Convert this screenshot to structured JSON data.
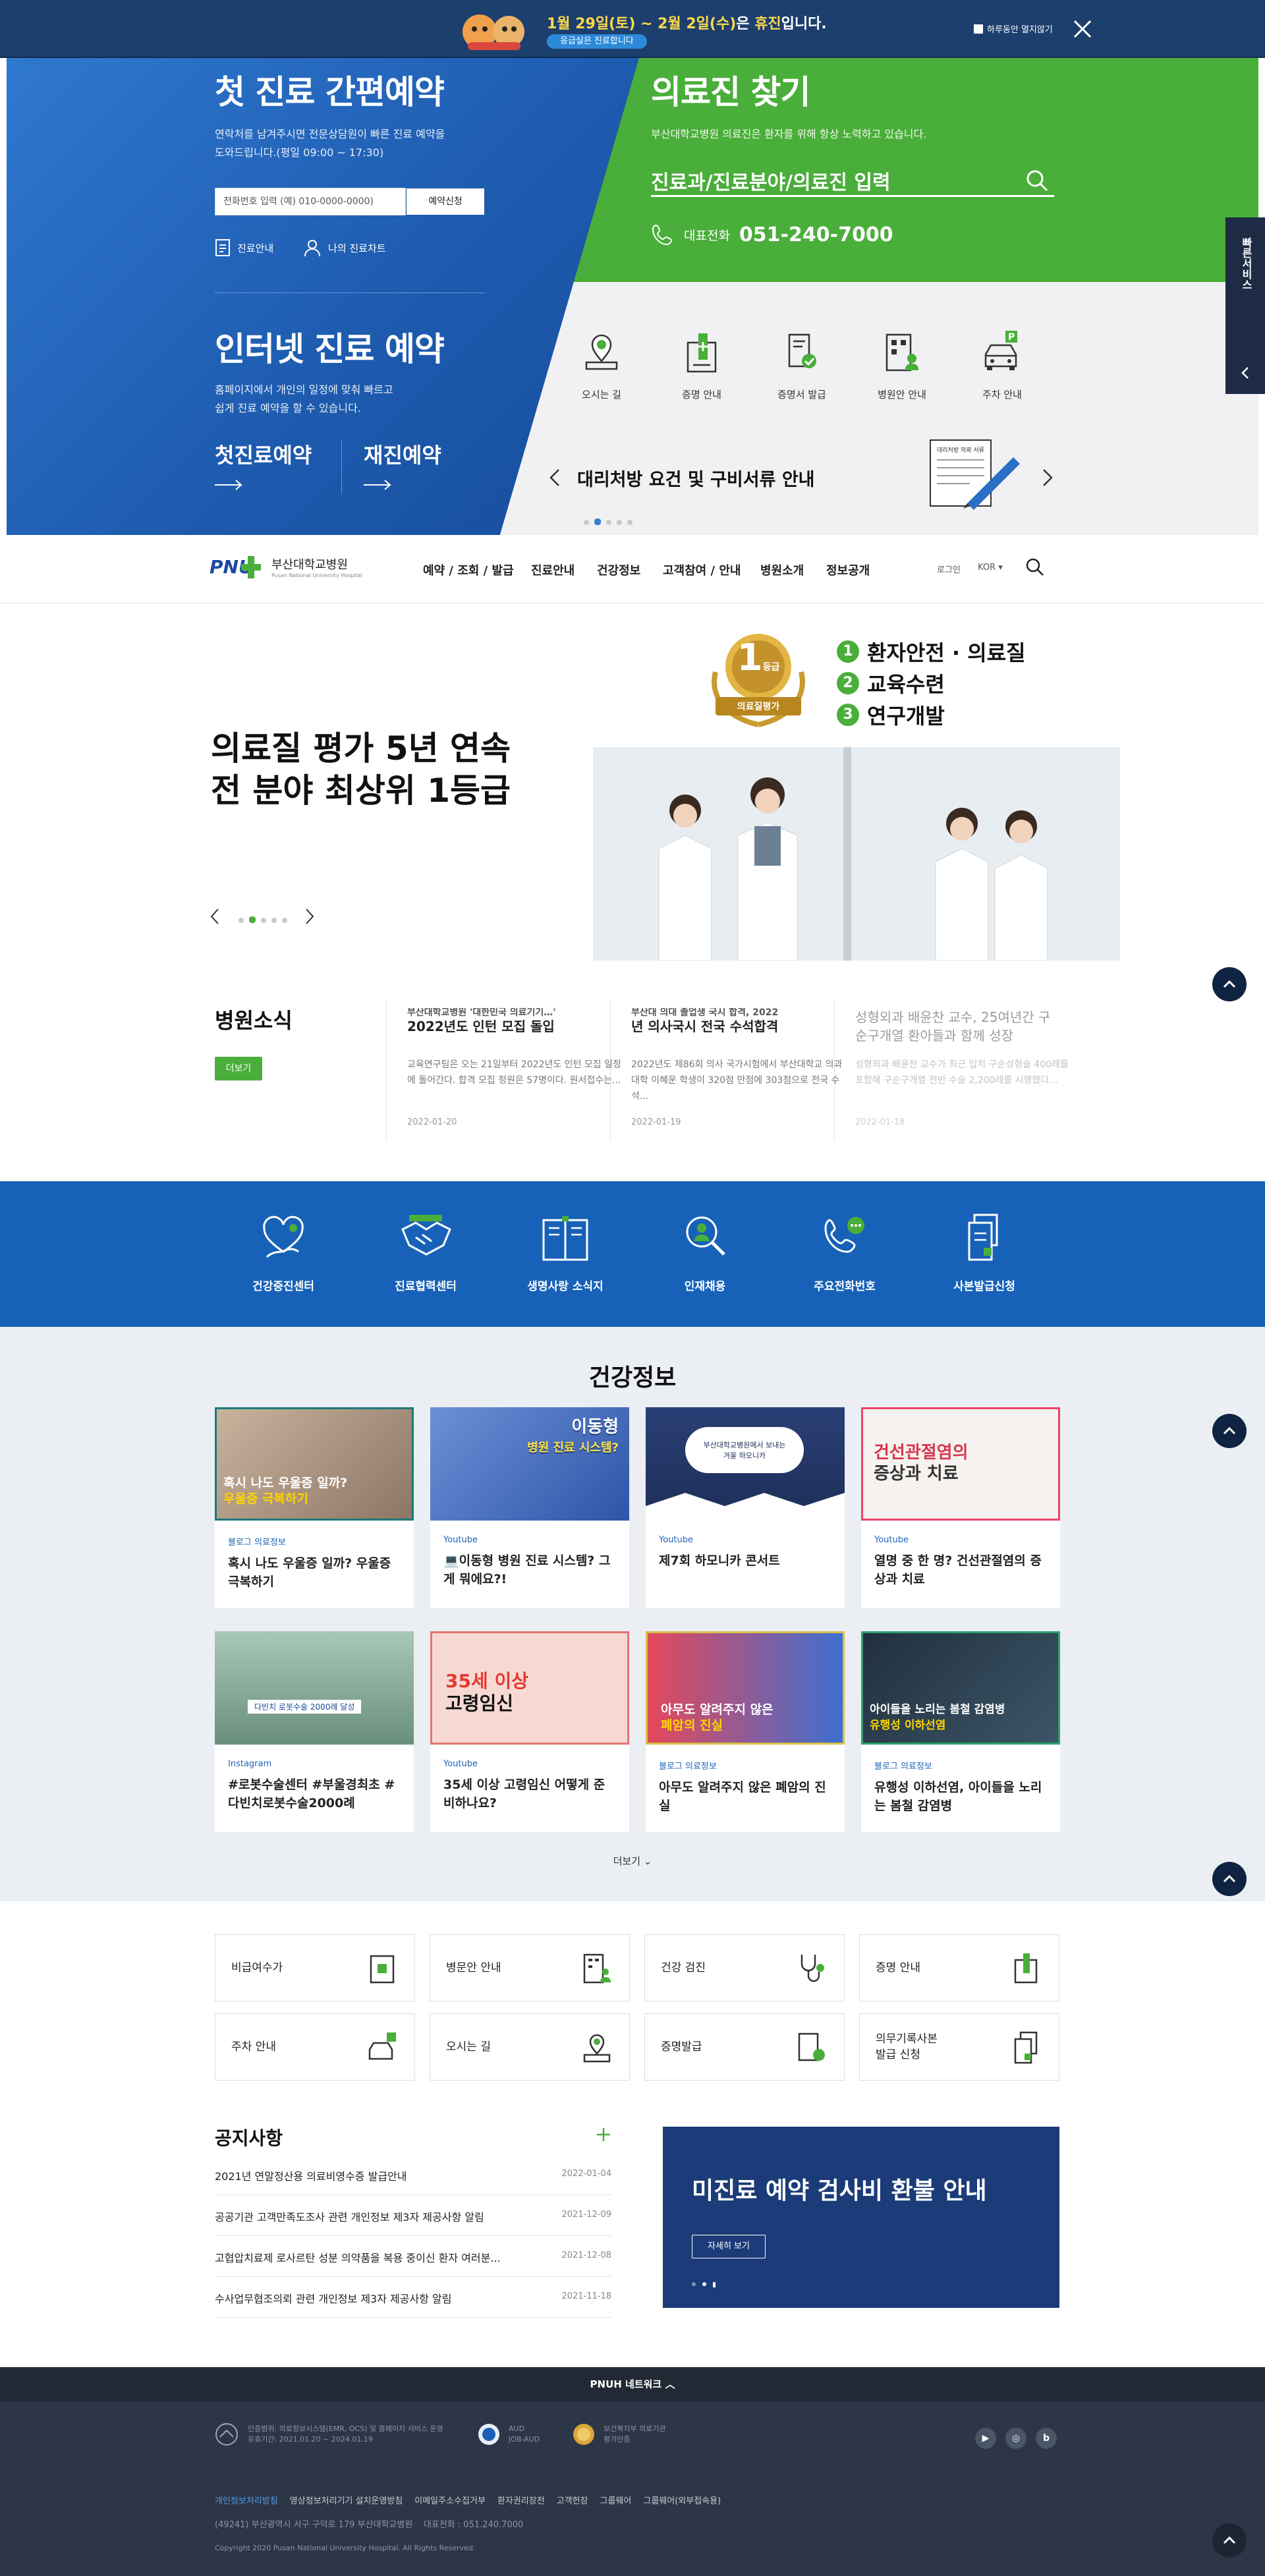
{
  "notice": {
    "title_pre": "1월 29일(토) ~ 2월 2일(수)",
    "title_mid": "은 ",
    "title_hl": "휴진",
    "title_post": "입니다.",
    "pill": "응급실은 진료합니다",
    "close_today": "하루동안 열지않기"
  },
  "hero": {
    "reserve": {
      "title": "첫 진료 간편예약",
      "desc1": "연락처를 남겨주시면 전문상담원이 빠른 진료 예약을",
      "desc2": "도와드립니다.(평일 09:00 ~ 17:30)",
      "phone_placeholder": "전화번호 입력 (예) 010-0000-0000)",
      "apply": "예약신청",
      "guide": "진료안내",
      "my_chart": "나의 진료차트"
    },
    "internet": {
      "title": "인터넷 진료 예약",
      "desc1": "홈페이지에서 개인의 일정에 맞춰 빠르고",
      "desc2": "쉽게 진료 예약을 할 수 있습니다.",
      "first": "첫진료예약",
      "again": "재진예약"
    },
    "doctor": {
      "title": "의료진 찾기",
      "desc": "부산대학교병원 의료진은 환자를 위해 항상 노력하고 있습니다.",
      "search_placeholder": "진료과/진료분야/의료진 입력",
      "phone_label": "대표전화",
      "phone": "051-240-7000"
    },
    "quick": [
      {
        "label": "오시는 길",
        "icon": "map-pin-icon"
      },
      {
        "label": "증명 안내",
        "icon": "certificate-icon"
      },
      {
        "label": "증명서 발급",
        "icon": "document-check-icon"
      },
      {
        "label": "병원안 안내",
        "icon": "building-icon"
      },
      {
        "label": "주차 안내",
        "icon": "car-parking-icon"
      }
    ],
    "slide_text": "대리처방 요건 및 구비서류 안내",
    "slide_img_text": "대리처방 의뢰 서류",
    "side_label": "빠른서비스"
  },
  "gnb": {
    "logo": "PNUH",
    "hospital": "부산대학교병원",
    "hospital_en": "Pusan National University Hospital",
    "menu": [
      "예약 / 조회 / 발급",
      "진료안내",
      "건강정보",
      "고객참여 / 안내",
      "병원소개",
      "정보공개"
    ],
    "login": "로그인",
    "lang": "KOR"
  },
  "main_visual": {
    "title1": "의료질 평가 5년 연속",
    "title2": "전 분야 최상위 1등급",
    "badge_num": "1",
    "badge_unit": "등급",
    "badge_label": "의료질평가",
    "items": [
      {
        "num": "1",
        "label": "환자안전 · 의료질"
      },
      {
        "num": "2",
        "label": "교육수련"
      },
      {
        "num": "3",
        "label": "연구개발"
      }
    ]
  },
  "news": {
    "title": "병원소식",
    "more": "더보기",
    "items": [
      {
        "title_top": "부산대학교병원 '대한민국 의료기기…'",
        "title": "2022년도 인턴 모집 돌입",
        "desc": "교육연구팀은 오는 21일부터 2022년도 인턴 모집 일정에 돌어간다. 합격 모집 정원은 57명이다. 원서접수는...",
        "date": "2022-01-20"
      },
      {
        "title_top": "부산대 의대 졸업생 국시 합격, 2022",
        "title": "년 의사국시 전국 수석합격",
        "desc": "2022년도 제86회 의사 국가시험에서 부산대학교 의과대학 이혜운 학생이 320점 만점에 303점으로 전국 수석...",
        "date": "2022-01-19"
      },
      {
        "title_top": "성형외과 배윤찬 교수, 25여년간 구",
        "title": "순구개열 환아들과 함께 성장",
        "desc": "성형외과 배윤찬 교수가 최근 입치 구순성형술 400례를 포함해 구순구개열 전반 수술 2,200례를 시행했다...",
        "date": "2022-01-18"
      }
    ]
  },
  "band": [
    {
      "label": "건강증진센터",
      "icon": "heart-hand-icon"
    },
    {
      "label": "진료협력센터",
      "icon": "handshake-icon"
    },
    {
      "label": "생명사랑 소식지",
      "icon": "book-icon"
    },
    {
      "label": "인재채용",
      "icon": "person-search-icon"
    },
    {
      "label": "주요전화번호",
      "icon": "phone-icon"
    },
    {
      "label": "사본발급신청",
      "icon": "copy-document-icon"
    }
  ],
  "health": {
    "title": "건강정보",
    "more": "더보기",
    "cards": [
      {
        "cat": "블로그 의료정보",
        "title": "혹시 나도 우울증 일까? 우울증 극복하기",
        "cap1": "혹시 나도 우울증 일까?",
        "cap2": "우울증 극복하기"
      },
      {
        "cat": "Youtube",
        "title": "💻이동형 병원 진료 시스템? 그게 뭐에요?!",
        "cap1": "이동형",
        "cap2": "병원 진료 시스템?"
      },
      {
        "cat": "Youtube",
        "title": "제7회 하모니카 콘서트",
        "cap1": "부산대학교병원에서 보내는",
        "cap2": "겨울 하모니카"
      },
      {
        "cat": "Youtube",
        "title": "열명 중 한 명? 건선관절염의 증상과 치료",
        "cap1": "건선관절염의",
        "cap2": "증상과 치료"
      },
      {
        "cat": "Instagram",
        "title": "#로봇수술센터 #부울경최초 #다빈치로봇수술2000례",
        "cap1": "다빈치 로봇수술 2000례 달성",
        "cap2": ""
      },
      {
        "cat": "Youtube",
        "title": "35세 이상 고령임신 어떻게 준비하나요?",
        "cap1": "35세 이상",
        "cap2": "고령임신"
      },
      {
        "cat": "블로그 의료정보",
        "title": "아무도 알려주지 않은 폐암의 진실",
        "cap1": "아무도 알려주지 않은",
        "cap2": "폐암의 진실"
      },
      {
        "cat": "블로그 의료정보",
        "title": "유행성 이하선염, 아이들을 노리는 봄철 감염병",
        "cap1": "아이들을 노리는 봄철 감염병",
        "cap2": "유행성 이하선염"
      }
    ]
  },
  "services": [
    {
      "label": "비급여수가",
      "icon": "won-document-icon"
    },
    {
      "label": "병문안 안내",
      "icon": "building-person-icon"
    },
    {
      "label": "건강 검진",
      "icon": "stethoscope-icon"
    },
    {
      "label": "증명 안내",
      "icon": "certificate-icon"
    },
    {
      "label": "주차 안내",
      "icon": "car-parking-icon"
    },
    {
      "label": "오시는 길",
      "icon": "map-pin-icon"
    },
    {
      "label": "증명발급",
      "icon": "document-check-icon"
    },
    {
      "label": "의무기록사본\n발급 신청",
      "icon": "copy-document-icon"
    }
  ],
  "notices": {
    "title": "공지사항",
    "items": [
      {
        "title": "2021년 연말정산용 의료비영수증 발급안내",
        "date": "2022-01-04"
      },
      {
        "title": "공공기관 고객만족도조사 관련 개인정보 제3자 제공사항 알림",
        "date": "2021-12-09"
      },
      {
        "title": "고협압치료제 로사르탄 성분 의약품을 복용 중이신 환자 여러분...",
        "date": "2021-12-08"
      },
      {
        "title": "수사업무협조의뢰 관련 개인정보 제3자 제공사항 알림",
        "date": "2021-11-18"
      }
    ],
    "banner_title": "미진료 예약 검사비 환불 안내",
    "banner_btn": "자세히 보기"
  },
  "footer": {
    "network": "PNUH 네트워크",
    "cert1a": "인증범위: 의료정보시스템(EMR, OCS) 및 홈페이지 서비스 운영",
    "cert1b": "유효기간: 2021.01.20 ~ 2024.01.19",
    "cert2a": "AUD",
    "cert2b": "JOB-AUD",
    "cert3a": "보건복지부 의료기관",
    "cert3b": "평가인증",
    "links": [
      "개인정보처리방침",
      "영상정보처리기기 설치운영방침",
      "이메일주소수집거부",
      "환자권리장전",
      "고객헌장",
      "그룹웨어",
      "그룹웨어(외부접속용)"
    ],
    "address": "(49241) 부산광역시 서구 구덕로 179 부산대학교병원    대표전화 : 051.240.7000",
    "copyright": "Copyright 2020 Pusan National University Hospital. All Rights Reserved."
  }
}
